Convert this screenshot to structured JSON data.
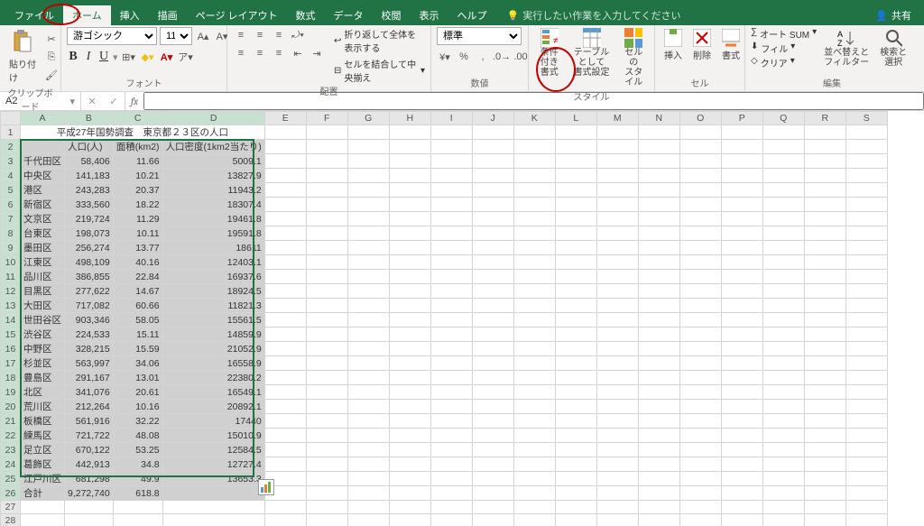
{
  "menubar": {
    "tabs": [
      "ファイル",
      "ホーム",
      "挿入",
      "描画",
      "ページ レイアウト",
      "数式",
      "データ",
      "校閲",
      "表示",
      "ヘルプ"
    ],
    "active_index": 1,
    "tellme_placeholder": "実行したい作業を入力してください",
    "share": "共有"
  },
  "ribbon": {
    "clipboard": {
      "paste": "貼り付け",
      "label": "クリップボード"
    },
    "font": {
      "name": "游ゴシック",
      "size": "11",
      "label": "フォント"
    },
    "align": {
      "wrap": "折り返して全体を表示する",
      "merge": "セルを結合して中央揃え",
      "label": "配置"
    },
    "number": {
      "format": "標準",
      "label": "数値"
    },
    "styles": {
      "cond": "条件付き\n書式",
      "table": "テーブルとして\n書式設定",
      "cell": "セルの\nスタイル",
      "label": "スタイル"
    },
    "cells": {
      "insert": "挿入",
      "delete": "削除",
      "format": "書式",
      "label": "セル"
    },
    "editing": {
      "sum": "オート SUM",
      "fill": "フィル",
      "clear": "クリア",
      "sort": "並べ替えと\nフィルター",
      "find": "検索と\n選択",
      "label": "編集"
    }
  },
  "namebox": "A2",
  "sheet": {
    "title": "平成27年国勢調査　東京都２３区の人口",
    "headers": [
      "",
      "人口(人)",
      "面積(km2)",
      "人口密度(1km2当たり)"
    ],
    "rows": [
      [
        "千代田区",
        "58,406",
        "11.66",
        "5009.1"
      ],
      [
        "中央区",
        "141,183",
        "10.21",
        "13827.9"
      ],
      [
        "港区",
        "243,283",
        "20.37",
        "11943.2"
      ],
      [
        "新宿区",
        "333,560",
        "18.22",
        "18307.4"
      ],
      [
        "文京区",
        "219,724",
        "11.29",
        "19461.8"
      ],
      [
        "台東区",
        "198,073",
        "10.11",
        "19591.8"
      ],
      [
        "墨田区",
        "256,274",
        "13.77",
        "18611"
      ],
      [
        "江東区",
        "498,109",
        "40.16",
        "12403.1"
      ],
      [
        "品川区",
        "386,855",
        "22.84",
        "16937.6"
      ],
      [
        "目黒区",
        "277,622",
        "14.67",
        "18924.5"
      ],
      [
        "大田区",
        "717,082",
        "60.66",
        "11821.3"
      ],
      [
        "世田谷区",
        "903,346",
        "58.05",
        "15561.5"
      ],
      [
        "渋谷区",
        "224,533",
        "15.11",
        "14859.9"
      ],
      [
        "中野区",
        "328,215",
        "15.59",
        "21052.9"
      ],
      [
        "杉並区",
        "563,997",
        "34.06",
        "16558.9"
      ],
      [
        "豊島区",
        "291,167",
        "13.01",
        "22380.2"
      ],
      [
        "北区",
        "341,076",
        "20.61",
        "16549.1"
      ],
      [
        "荒川区",
        "212,264",
        "10.16",
        "20892.1"
      ],
      [
        "板橋区",
        "561,916",
        "32.22",
        "17440"
      ],
      [
        "練馬区",
        "721,722",
        "48.08",
        "15010.9"
      ],
      [
        "足立区",
        "670,122",
        "53.25",
        "12584.5"
      ],
      [
        "葛飾区",
        "442,913",
        "34.8",
        "12727.4"
      ],
      [
        "江戸川区",
        "681,298",
        "49.9",
        "13653.3"
      ],
      [
        "合計",
        "9,272,740",
        "618.8",
        ""
      ]
    ],
    "cols": [
      "A",
      "B",
      "C",
      "D",
      "E",
      "F",
      "G",
      "H",
      "I",
      "J",
      "K",
      "L",
      "M",
      "N",
      "O",
      "P",
      "Q",
      "R",
      "S"
    ]
  }
}
